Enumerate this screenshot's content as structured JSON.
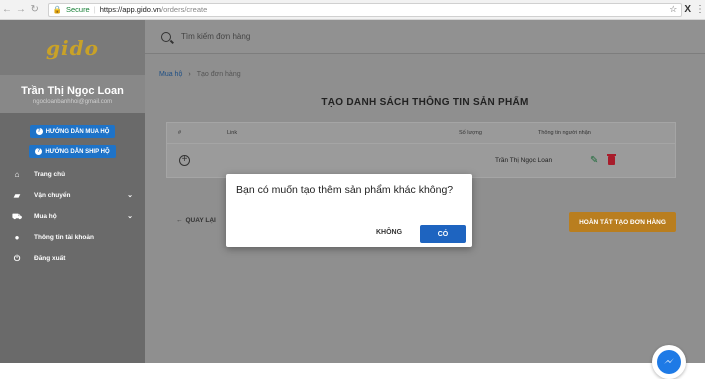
{
  "browser": {
    "secure_label": "Secure",
    "url_host": "https://app.gido.vn",
    "url_path": "/orders/create"
  },
  "sidebar": {
    "logo": "gido",
    "user_name": "Trần Thị Ngọc Loan",
    "user_email": "ngocloanbanhhoi@gmail.com",
    "guide_buttons": [
      "HƯỚNG DẪN MUA HỘ",
      "HƯỚNG DẪN SHIP HỘ"
    ],
    "menu": [
      {
        "label": "Trang chủ",
        "icon": "home-icon"
      },
      {
        "label": "Vận chuyển",
        "icon": "truck-icon"
      },
      {
        "label": "Mua hộ",
        "icon": "cart-icon"
      },
      {
        "label": "Thông tin tài khoản",
        "icon": "user-icon"
      },
      {
        "label": "Đăng xuất",
        "icon": "power-icon"
      }
    ]
  },
  "search": {
    "placeholder": "Tìm kiếm đơn hàng"
  },
  "breadcrumb": {
    "home": "Mua hộ",
    "current": "Tạo đơn hàng"
  },
  "page_title": "TẠO DANH SÁCH THÔNG TIN SẢN PHẨM",
  "table": {
    "headers": [
      "#",
      "Link",
      "Số lượng",
      "Thông tin người nhận"
    ],
    "row": {
      "receiver": "Trần Thị Ngọc Loan"
    }
  },
  "actions": {
    "back": "QUAY LẠI",
    "finish": "HOÀN TẤT TẠO ĐƠN HÀNG"
  },
  "modal": {
    "question": "Bạn có muốn tạo thêm sản phẩm khác không?",
    "no": "KHÔNG",
    "yes": "CÓ"
  }
}
